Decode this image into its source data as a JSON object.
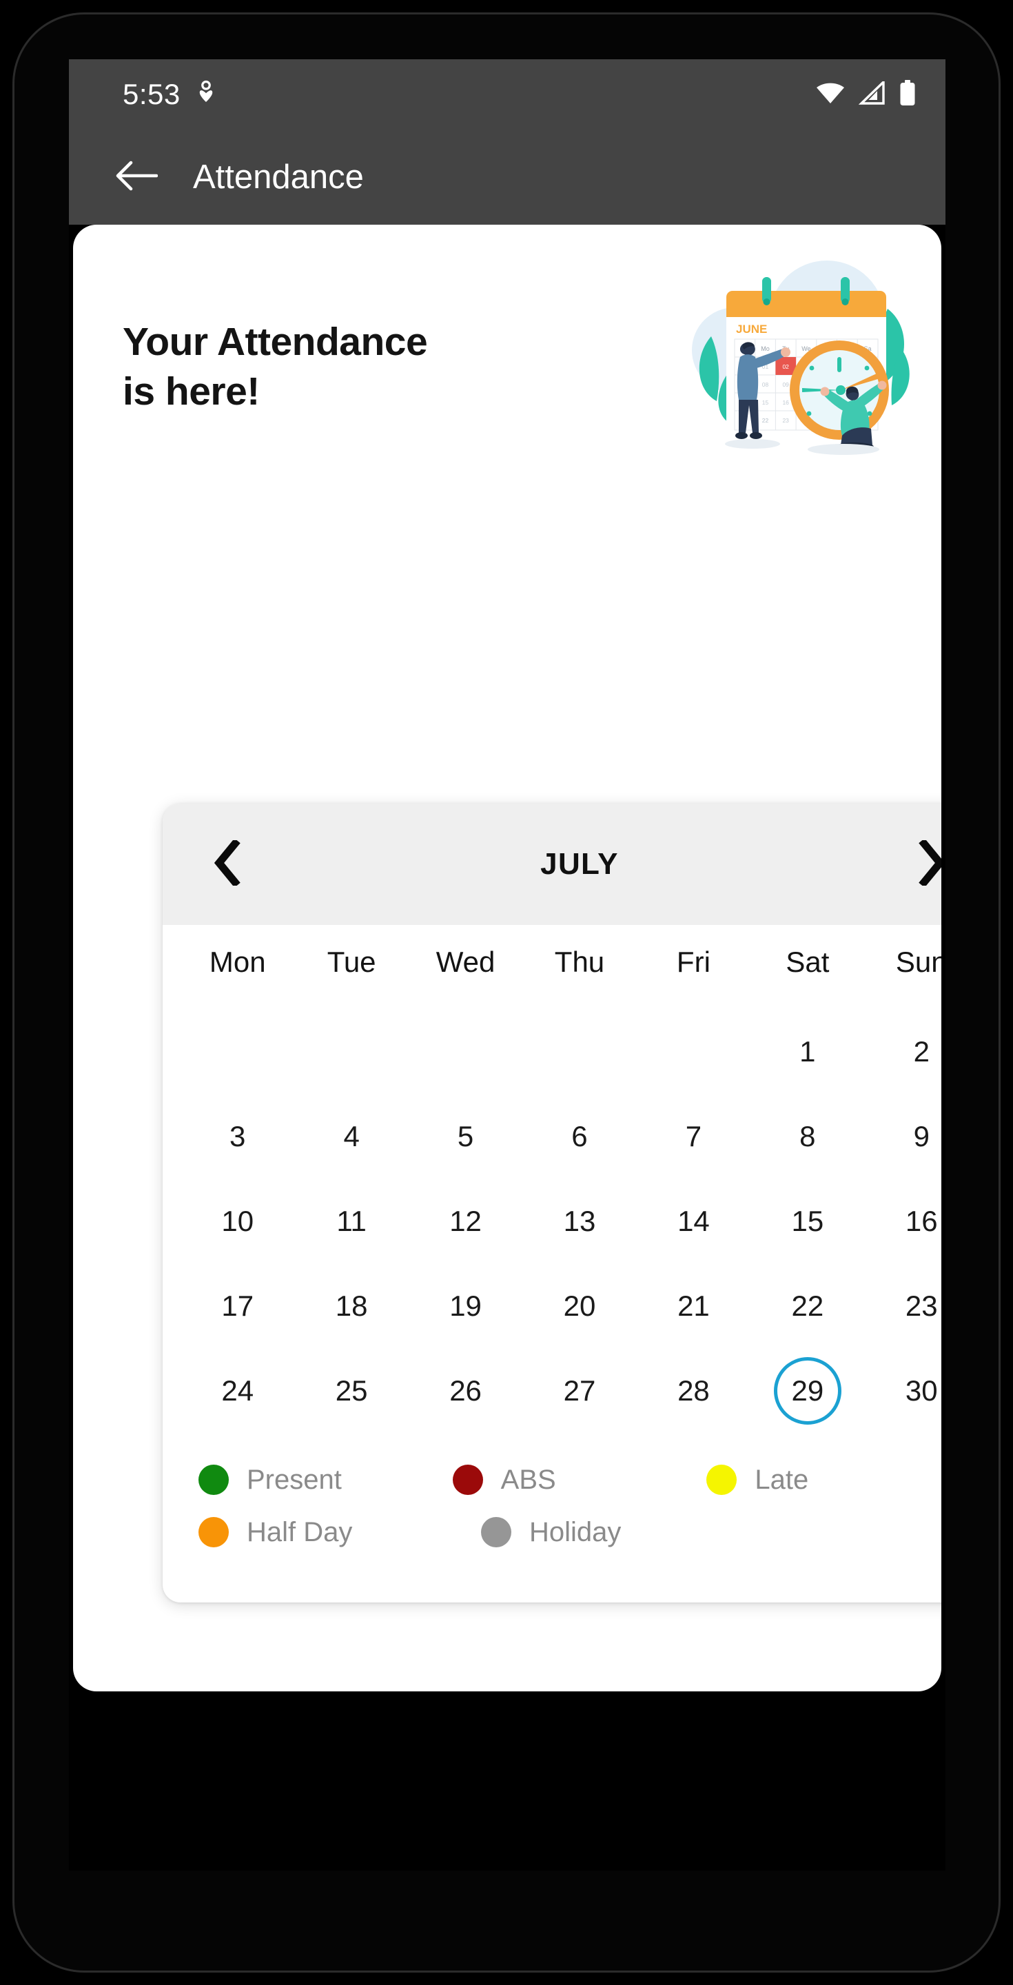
{
  "status_bar": {
    "time": "5:53",
    "location_icon": "location-pin-icon",
    "wifi_icon": "wifi-icon",
    "signal_icon": "cellular-signal-icon",
    "battery_icon": "battery-full-icon"
  },
  "app_bar": {
    "back_icon": "back-arrow-icon",
    "title": "Attendance"
  },
  "hero": {
    "title_line1": "Your Attendance",
    "title_line2": "is here!",
    "illustration_name": "calendar-clock-illustration",
    "illustration_month_label": "JUNE",
    "illustration_weekdays": [
      "Su",
      "Mo",
      "Tu",
      "We",
      "Th",
      "Fr",
      "Sa"
    ],
    "illustration_highlight_day": "02"
  },
  "calendar": {
    "prev_icon": "chevron-left-icon",
    "next_icon": "chevron-right-icon",
    "month": "JULY",
    "weekdays": [
      "Mon",
      "Tue",
      "Wed",
      "Thu",
      "Fri",
      "Sat",
      "Sun"
    ],
    "leading_blanks": 5,
    "days": [
      "1",
      "2",
      "3",
      "4",
      "5",
      "6",
      "7",
      "8",
      "9",
      "10",
      "11",
      "12",
      "13",
      "14",
      "15",
      "16",
      "17",
      "18",
      "19",
      "20",
      "21",
      "22",
      "23",
      "24",
      "25",
      "26",
      "27",
      "28",
      "29",
      "30"
    ],
    "selected_day": "29",
    "selected_color": "#1BA1D2",
    "header_bg": "#EFEFEF"
  },
  "legend": {
    "rows": [
      [
        {
          "label": "Present",
          "color": "#108A10",
          "name": "legend-present"
        },
        {
          "label": "ABS",
          "color": "#9B0A0A",
          "name": "legend-abs"
        },
        {
          "label": "Late",
          "color": "#F5F500",
          "name": "legend-late"
        }
      ],
      [
        {
          "label": "Half Day",
          "color": "#F89407",
          "name": "legend-half-day"
        },
        {
          "label": "Holiday",
          "color": "#969696",
          "name": "legend-holiday"
        }
      ]
    ]
  },
  "nav": {
    "gesture_pill": "home-gesture-pill"
  }
}
